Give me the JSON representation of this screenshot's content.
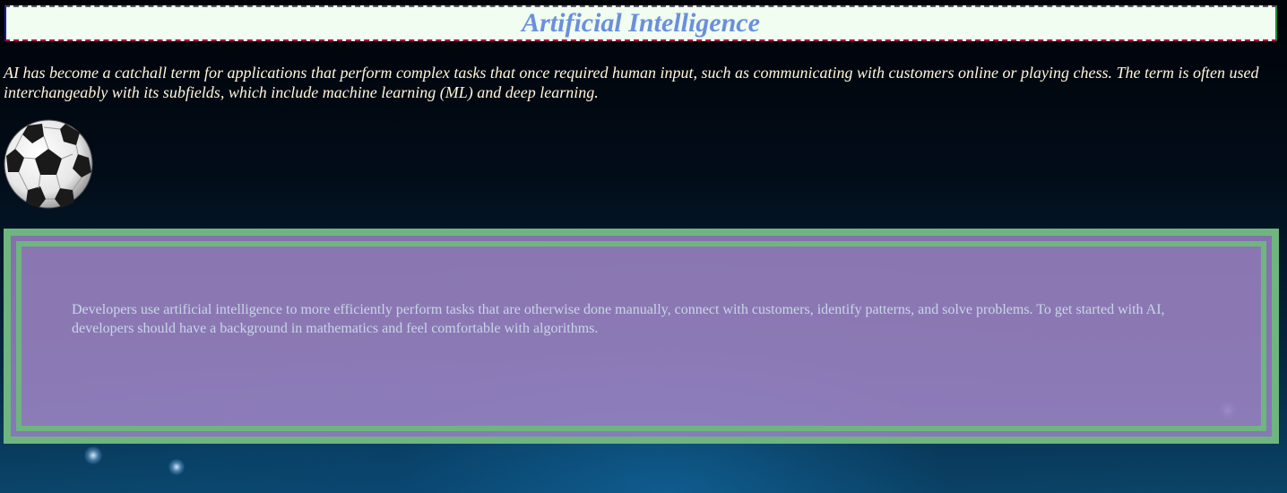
{
  "header": {
    "title": "Artificial Intelligence"
  },
  "intro": {
    "text": "AI has become a catchall term for applications that perform complex tasks that once required human input, such as communicating with customers online or playing chess. The term is often used interchangeably with its subfields, which include machine learning (ML) and deep learning."
  },
  "image": {
    "icon": "soccer-ball-icon"
  },
  "panel": {
    "text": "Developers use artificial intelligence to more efficiently perform tasks that are otherwise done manually, connect with customers, identify patterns, and solve problems. To get started with AI, developers should have a background in mathematics and feel comfortable with algorithms."
  },
  "colors": {
    "title": "#6b8fdc",
    "title_background": "#f0fdf0",
    "intro_text": "#fff6dc",
    "frame_border": "#6fb57f",
    "panel_fill": "#a88cd2",
    "panel_text": "#c8d6e8"
  }
}
